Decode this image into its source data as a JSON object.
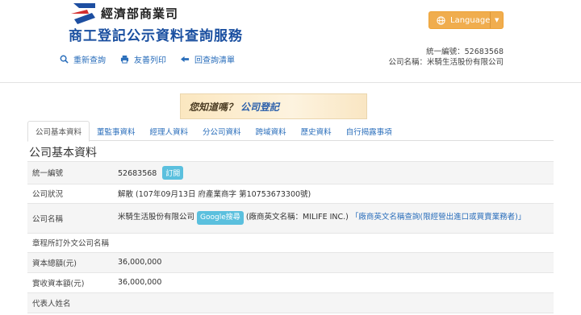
{
  "header": {
    "ministry": "經濟部商業司",
    "service_title": "商工登記公示資料查詢服務",
    "toolbar": [
      {
        "icon": "search-icon",
        "label": "重新查詢"
      },
      {
        "icon": "printer-icon",
        "label": "友善列印"
      },
      {
        "icon": "arrow-left-icon",
        "label": "回查詢清單"
      }
    ],
    "language_label": "Language",
    "company_meta": {
      "id_line": "統一編號：52683568",
      "name_line": "公司名稱：米騎生活股份有限公司"
    }
  },
  "banner": {
    "text": "您知道嗎？",
    "highlight": "公司登記"
  },
  "tabs": [
    "公司基本資料",
    "董監事資料",
    "經理人資料",
    "分公司資料",
    "跨域資料",
    "歷史資料",
    "自行揭露事項"
  ],
  "section_title": "公司基本資料",
  "rows": {
    "tax_id": {
      "label": "統一編號",
      "value": "52683568",
      "badge": "訂閱"
    },
    "status": {
      "label": "公司狀況",
      "value": "解散 (107年09月13日 府產業商字 第10753673300號)"
    },
    "name": {
      "label": "公司名稱",
      "value": "米騎生活股份有限公司",
      "google_badge": "Google搜尋",
      "english": "(廠商英文名稱：MILIFE INC.)",
      "link": "「廠商英文名稱查詢(限經營出進口或買賣業務者)」"
    },
    "foreign_name": {
      "label": "章程所訂外文公司名稱",
      "value": ""
    },
    "capital_total": {
      "label": "資本總額(元)",
      "value": "36,000,000"
    },
    "capital_paid": {
      "label": "實收資本額(元)",
      "value": "36,000,000"
    },
    "representative": {
      "label": "代表人姓名",
      "value": ""
    }
  },
  "colors": {
    "accent_blue": "#2a6ebb",
    "language_button": "#f0ad4e",
    "badge": "#5bc0de"
  }
}
